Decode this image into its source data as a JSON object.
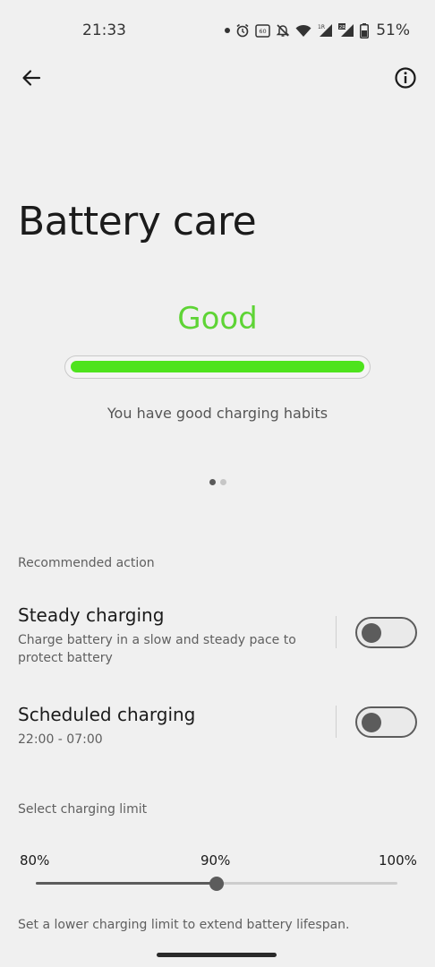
{
  "status_bar": {
    "time": "21:33",
    "battery_percent": "51%",
    "icons": [
      "notification-dot-icon",
      "alarm-icon",
      "nfc-icon",
      "bell-off-icon",
      "wifi-icon",
      "signal-1r-icon",
      "signal-2r-icon",
      "battery-icon"
    ]
  },
  "app_bar": {
    "back_icon": "arrow-back-icon",
    "info_icon": "info-icon"
  },
  "page": {
    "title": "Battery care"
  },
  "health": {
    "status": "Good",
    "status_color": "#5ed435",
    "bar_color": "#4ee31d",
    "level_fraction": 1.0,
    "message": "You have good charging habits",
    "pager_count": 2,
    "pager_active": 0
  },
  "recommended": {
    "header": "Recommended action",
    "items": [
      {
        "title": "Steady charging",
        "description": "Charge battery in a slow and steady pace to protect battery",
        "enabled": false
      },
      {
        "title": "Scheduled charging",
        "description": "22:00 - 07:00",
        "enabled": false
      }
    ]
  },
  "charging_limit": {
    "header": "Select charging limit",
    "options": [
      "80%",
      "90%",
      "100%"
    ],
    "selected": "90%",
    "selected_fraction": 0.5,
    "note": "Set a lower charging limit to extend battery lifespan."
  }
}
